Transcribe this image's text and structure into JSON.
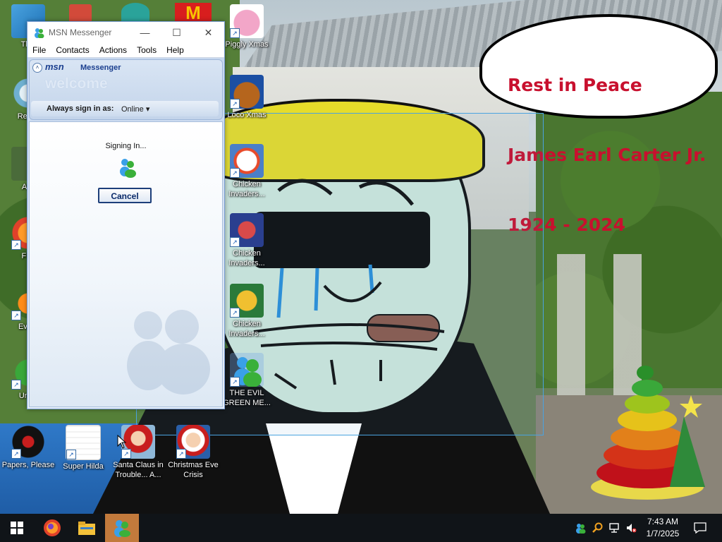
{
  "speech_bubble": {
    "line1": "Rest in Peace",
    "line2": "James Earl Carter Jr.",
    "line3": "1924 - 2024"
  },
  "desktop_icons": [
    {
      "label": "This",
      "icon": "this-pc-icon"
    },
    {
      "label": "Recyc",
      "icon": "recycle-bin-icon"
    },
    {
      "label": "Acti",
      "icon": "app-icon"
    },
    {
      "label": "Fire",
      "icon": "firefox-icon"
    },
    {
      "label": "Every",
      "icon": "app-icon"
    },
    {
      "label": "Undo",
      "icon": "app-icon"
    },
    {
      "label": "Piggly Xmas",
      "icon": "piggly-xmas-icon"
    },
    {
      "label": "Loco Xmas",
      "icon": "loco-xmas-icon"
    },
    {
      "label": "Chicken Invaders...",
      "icon": "chicken-invaders-icon"
    },
    {
      "label": "Chicken Invaders...",
      "icon": "chicken-invaders-icon"
    },
    {
      "label": "Chicken Invaders...",
      "icon": "chicken-invaders-icon"
    },
    {
      "label": "THE EVIL GREEN ME...",
      "icon": "msn-buddy-icon"
    },
    {
      "label": "Papers, Please",
      "icon": "papers-please-icon"
    },
    {
      "label": "Super Hilda",
      "icon": "super-hilda-icon"
    },
    {
      "label": "Santa Claus in Trouble... A...",
      "icon": "santa-claus-icon"
    },
    {
      "label": "Christmas Eve Crisis",
      "icon": "christmas-eve-icon"
    }
  ],
  "msn_window": {
    "title": "MSN Messenger",
    "menu": [
      "File",
      "Contacts",
      "Actions",
      "Tools",
      "Help"
    ],
    "logo": "msn",
    "logo_sub": "Messenger",
    "welcome": "welcome",
    "signin_label": "Always sign in as:",
    "signin_status": "Online",
    "status_text": "Signing In...",
    "cancel_label": "Cancel"
  },
  "taskbar": {
    "time": "7:43 AM",
    "date": "1/7/2025"
  }
}
